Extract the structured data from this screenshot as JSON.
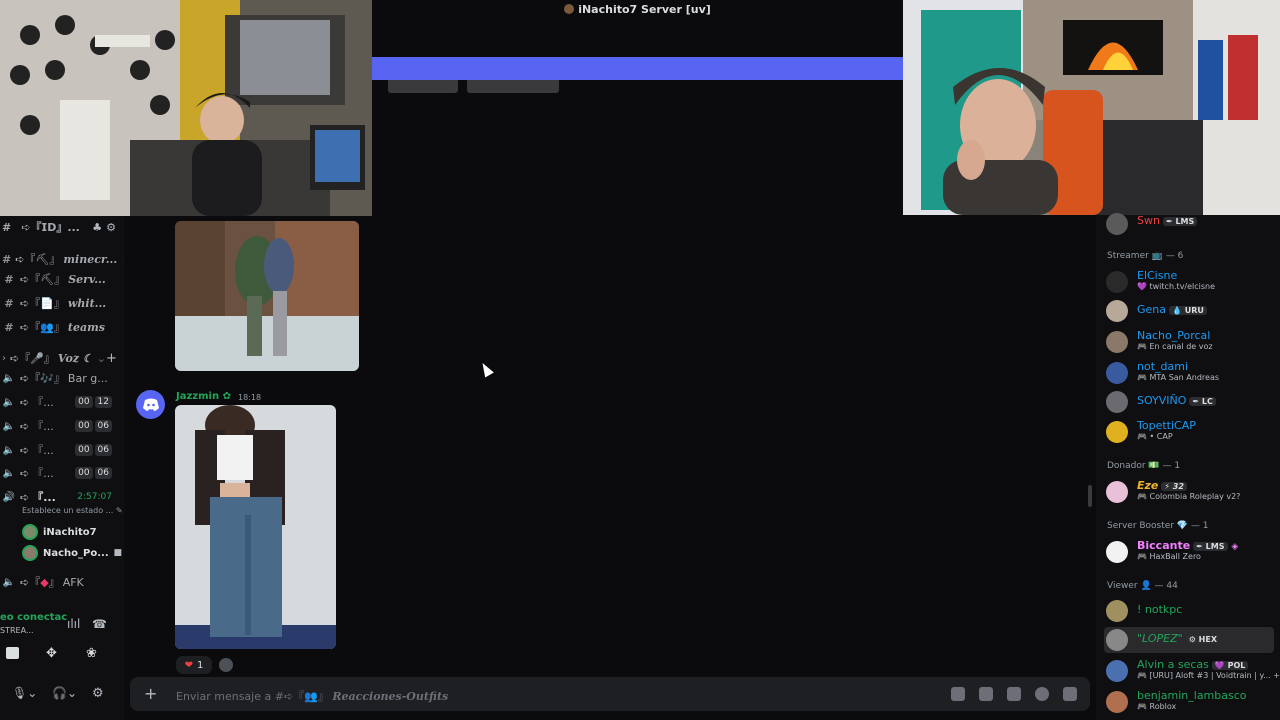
{
  "window": {
    "title": "iNachito7 Server [uv]"
  },
  "sidebar": {
    "top_row": {
      "label": "#ㅤ➪『𝗜𝗗』..."
    },
    "text_channels": [
      {
        "emoji": "⛏",
        "label": "minecr..."
      },
      {
        "emoji": "⛏",
        "label": "Serv..."
      },
      {
        "emoji": "📄",
        "label": "whit..."
      },
      {
        "emoji": "👥",
        "label": "teams"
      }
    ],
    "voice_category": {
      "label": "Voz ☾"
    },
    "voice_channels": [
      {
        "emoji": "🎶",
        "label": "Bar g..."
      },
      {
        "label": "『...",
        "count_a": "00",
        "count_b": "12"
      },
      {
        "label": "『...",
        "count_a": "00",
        "count_b": "06"
      },
      {
        "label": "『...",
        "count_a": "00",
        "count_b": "06"
      },
      {
        "label": "『...",
        "count_a": "00",
        "count_b": "06"
      },
      {
        "label": "『...",
        "timer": "2:57:07"
      }
    ],
    "status_placeholder": "Establece un estado ...",
    "voice_users": [
      {
        "name": "iNachito7"
      },
      {
        "name": "Nacho_Po..."
      }
    ],
    "afk_channel": {
      "label": "AFK"
    },
    "connection": {
      "status": "eo conectac",
      "sub": "STREA..."
    }
  },
  "chat": {
    "message": {
      "author": "Jazzmin",
      "time": "18:18"
    },
    "reaction": {
      "emoji": "❤",
      "count": "1"
    },
    "composer": {
      "prefix": "Enviar mensaje a #➪『👥』",
      "channel": "Reacciones-Outfits"
    }
  },
  "members": {
    "top": {
      "name": "Swn",
      "tag": "LMS",
      "color": "#f23f43"
    },
    "groups": [
      {
        "label": "Streamer 📺 — 6"
      },
      {
        "label": "Donador 💵 — 1"
      },
      {
        "label": "Server Booster 💎 — 1"
      },
      {
        "label": "Viewer 👤 — 44"
      }
    ],
    "streamers": [
      {
        "name": "ElCisne",
        "status": "💜 twitch.tv/elcisne",
        "color": "#1e9af0"
      },
      {
        "name": "Gena",
        "tag": "URU",
        "status": "",
        "color": "#1e9af0"
      },
      {
        "name": "Nacho_Porcal",
        "status": "🎮 En canal de voz",
        "color": "#1e9af0"
      },
      {
        "name": "not_dami",
        "status": "🎮 MTA San Andreas",
        "color": "#1e9af0"
      },
      {
        "name": "SOYVIÑO",
        "tag": "LC",
        "status": "",
        "color": "#1e9af0"
      },
      {
        "name": "TopettiCAP",
        "status": "🎮 • CAP",
        "color": "#1e9af0"
      }
    ],
    "donador": [
      {
        "name": "Eze",
        "tag": "32",
        "status": "🎮 Colombia Roleplay v2?",
        "color": "#f0b232"
      }
    ],
    "boosters": [
      {
        "name": "Biccante",
        "tag": "LMS",
        "status": "🎮 HaxBall Zero",
        "color": "#f47fff"
      }
    ],
    "viewers": [
      {
        "name": "! notkpc",
        "status": "",
        "color": "#23a559"
      },
      {
        "name": "\"LOPEZ\"",
        "tag": "HEX",
        "status": "",
        "color": "#23a559"
      },
      {
        "name": "Alvin a secas",
        "tag": "POL",
        "status": "🎮 [URU] Aloft #3 | Voidtrain | y... +1",
        "color": "#23a559"
      },
      {
        "name": "benjamin_lambasco",
        "status": "🎮 Roblox",
        "color": "#23a559"
      }
    ]
  }
}
